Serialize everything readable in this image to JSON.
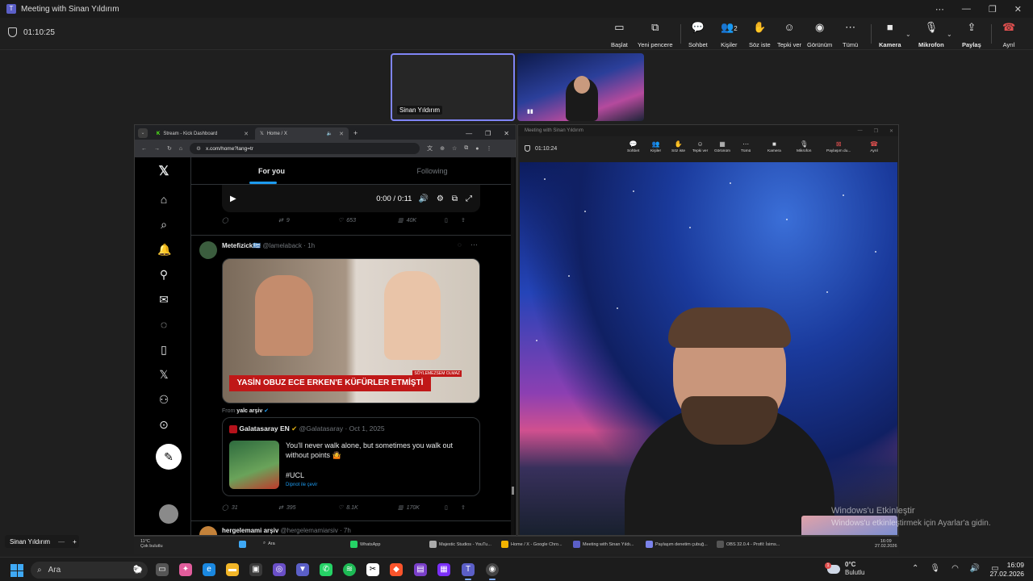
{
  "titlebar": {
    "title": "Meeting with Sinan Yıldırım",
    "app_icon": "teams-icon"
  },
  "meeting": {
    "timer": "01:10:25",
    "toolbar": [
      {
        "label": "Başlat",
        "icon": "▭"
      },
      {
        "label": "Yeni pencere",
        "icon": "⧉"
      },
      {
        "label": "Sohbet",
        "icon": "💬"
      },
      {
        "label": "Kişiler",
        "icon": "👥",
        "count": "2"
      },
      {
        "label": "Söz iste",
        "icon": "✋"
      },
      {
        "label": "Tepki ver",
        "icon": "☺"
      },
      {
        "label": "Görünüm",
        "icon": "◉"
      },
      {
        "label": "Tümü",
        "icon": "⋯"
      },
      {
        "label": "Kamera",
        "icon": "■"
      },
      {
        "label": "Mikrofon",
        "icon": "🎙"
      },
      {
        "label": "Paylaş",
        "icon": "⇪"
      },
      {
        "label": "Ayrıl",
        "icon": "☎"
      }
    ],
    "participant_name": "Sinan Yıldırım",
    "stage_label": "Sinan Yıldırım"
  },
  "browser": {
    "tabs": [
      {
        "label": "Stream - Kick Dashboard"
      },
      {
        "label": "Home / X"
      }
    ],
    "url": "x.com/home?lang=tr",
    "feed_tabs": [
      "For you",
      "Following"
    ],
    "video": {
      "time": "0:00 / 0:11"
    },
    "post0_actions": {
      "retweets": "9",
      "likes": "653",
      "views": "40K"
    },
    "post1": {
      "author": "Metefizick🇬🇷",
      "handle": "@lamelaback · 1h",
      "image_banner": "YASİN OBUZ ECE ERKEN'E KÜFÜRLER ETMİŞTİ",
      "image_tag": "SÖYLEMEZSEM OLMAZ",
      "from_prefix": "From",
      "from_source": "yalc arşiv",
      "quote": {
        "author": "Galatasaray EN",
        "handle": "@Galatasaray · Oct 1, 2025",
        "text": "You'll never walk alone, but sometimes you walk out without points 🤷",
        "hashtag": "#UCL",
        "translate": "Dipnot ile çevir"
      },
      "actions": {
        "replies": "31",
        "retweets": "395",
        "likes": "8.1K",
        "views": "170K"
      }
    },
    "post2": {
      "author": "hergelemami arşiv",
      "handle": "@hergelemamiarsiv · 7h"
    }
  },
  "teams_inner": {
    "title": "Meeting with Sinan Yıldırım",
    "timer": "01:10:24",
    "toolbar": [
      "Sohbet",
      "Kişiler",
      "Söz iste",
      "Tepki ver",
      "Görünüm",
      "Tümü",
      "Kamera",
      "Mikrofon",
      "Paylaşım du...",
      "Ayrıl"
    ]
  },
  "watermark": {
    "line1": "Windows'u Etkinleştir",
    "line2": "Windows'u etkinleştirmek için Ayarlar'a gidin."
  },
  "inner_taskbar": {
    "weather_temp": "11°C",
    "weather_desc": "Çok bulutlu",
    "search": "Ara",
    "apps": [
      "WhatsApp",
      "Majestic Studios - YouTu...",
      "Home / X - Google Chro...",
      "Meeting with Sinan Yıldı...",
      "Paylaşım denetim çubuğ...",
      "OBS 32.0.4 - Profil: İsims..."
    ],
    "time": "16:09",
    "date": "27.02.2026"
  },
  "taskbar": {
    "search_placeholder": "Ara",
    "weather_temp": "0°C",
    "weather_desc": "Bulutlu",
    "weather_badge": "1",
    "time": "16:09",
    "date": "27.02.2026"
  }
}
